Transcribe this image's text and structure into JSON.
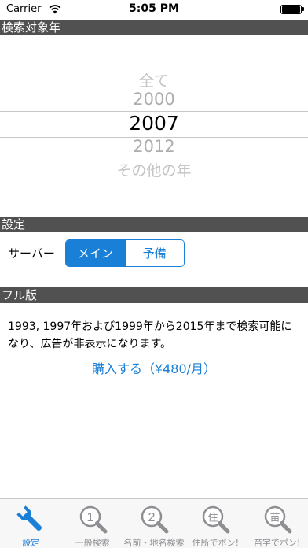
{
  "status_bar": {
    "carrier": "Carrier",
    "time": "5:05 PM"
  },
  "search_year": {
    "header": "検索対象年",
    "options": [
      "全て",
      "2000",
      "2007",
      "2012",
      "その他の年"
    ],
    "selected": "2007"
  },
  "settings": {
    "header": "設定",
    "server_label": "サーバー",
    "server_options": [
      "メイン",
      "予備"
    ],
    "server_selected": "メイン"
  },
  "full_version": {
    "header": "フル版",
    "description": "1993, 1997年および1999年から2015年まで検索可能になり、広告が非表示になります。",
    "buy_label": "購入する（¥480/月）"
  },
  "tab_bar": {
    "tabs": [
      {
        "label": "設定",
        "icon": "wrench-icon",
        "glyph": ""
      },
      {
        "label": "一般検索",
        "icon": "magnifier-1-icon",
        "glyph": "1"
      },
      {
        "label": "名前・地名検索",
        "icon": "magnifier-2-icon",
        "glyph": "2"
      },
      {
        "label": "住所でポン!",
        "icon": "magnifier-address-icon",
        "glyph": "住"
      },
      {
        "label": "苗字でポン!",
        "icon": "magnifier-surname-icon",
        "glyph": "苗"
      }
    ],
    "active": "設定"
  },
  "colors": {
    "accent": "#1a7fd6",
    "header_bg": "#515151",
    "tab_inactive": "#8e8e93"
  }
}
